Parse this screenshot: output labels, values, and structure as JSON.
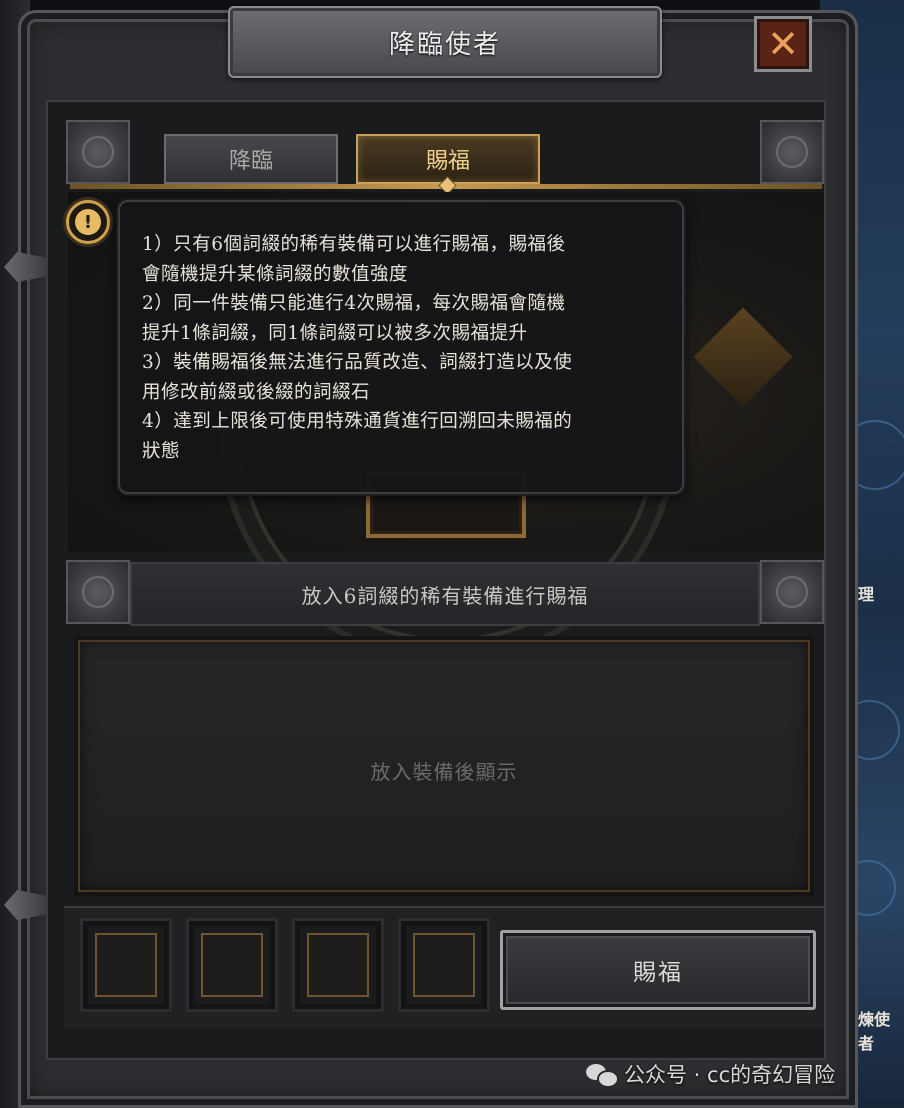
{
  "window": {
    "title": "降臨使者",
    "close_icon": "close-x-icon"
  },
  "tabs": [
    {
      "label": "降臨",
      "active": false
    },
    {
      "label": "賜福",
      "active": true
    }
  ],
  "tooltip": {
    "icon": "info-exclamation-icon",
    "lines": [
      "1）只有6個詞綴的稀有裝備可以進行賜福，賜福後",
      "會隨機提升某條詞綴的數值強度",
      "2）同一件裝備只能進行4次賜福，每次賜福會隨機",
      "提升1條詞綴，同1條詞綴可以被多次賜福提升",
      "3）裝備賜福後無法進行品質改造、詞綴打造以及使",
      "用修改前綴或後綴的詞綴石",
      "4）達到上限後可使用特殊通貨進行回溯回未賜福的",
      "狀態"
    ]
  },
  "instruction": "放入6詞綴的稀有裝備進行賜福",
  "display_placeholder": "放入裝備後顯示",
  "slots_count": 4,
  "confirm_button": "賜福",
  "background_side": {
    "text_top": "理",
    "text_bottom": "煉使者"
  },
  "watermark": "公众号 · cc的奇幻冒险",
  "colors": {
    "accent_gold": "#c9a15a",
    "active_tab_text": "#f2d48c",
    "close_bg": "#5a2316"
  }
}
